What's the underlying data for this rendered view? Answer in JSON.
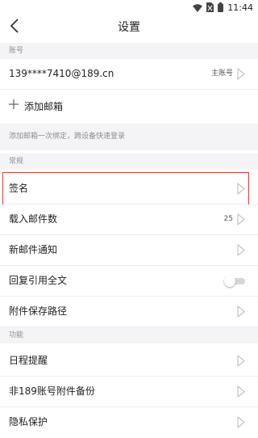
{
  "status_bar": {
    "time": "11:44",
    "icons": [
      "wifi-icon",
      "no-sim-icon",
      "battery-icon"
    ]
  },
  "header": {
    "title": "设置",
    "back_icon": "chevron-left-icon"
  },
  "sections": {
    "account": "账号",
    "general": "常规",
    "function": "功能"
  },
  "account": {
    "email": "139****7410@189.cn",
    "primary_label": "主账号",
    "add_label": "添加邮箱",
    "hint": "添加邮箱一次绑定，跨设备快速登录"
  },
  "general": {
    "signature": "签名",
    "load_count_label": "载入邮件数",
    "load_count_value": "25",
    "new_mail_notice": "新邮件通知",
    "reply_quote_label": "回复引用全文",
    "reply_quote_enabled": false,
    "attachment_path": "附件保存路径"
  },
  "function": {
    "schedule_reminder": "日程提醒",
    "non189_backup": "非189账号附件备份",
    "privacy": "隐私保护"
  },
  "colors": {
    "highlight": "#e53935",
    "section_bg": "#f4f4f6"
  }
}
